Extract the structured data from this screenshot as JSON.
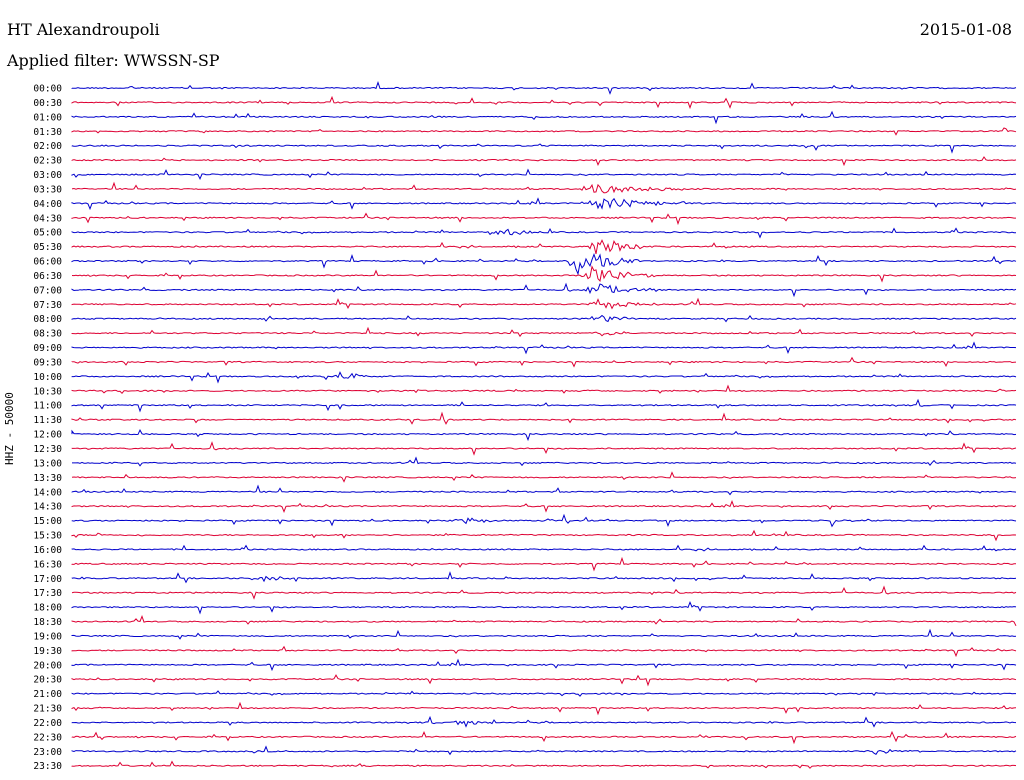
{
  "header": {
    "station": "HT Alexandroupoli",
    "date": "2015-01-08",
    "filter": "Applied filter: WWSSN-SP"
  },
  "chart_data": {
    "type": "line",
    "title": "HT Alexandroupoli",
    "subtitle": "Applied filter: WWSSN-SP",
    "date": "2015-01-08",
    "ylabel": "HHZ - 50000",
    "trace_colors": [
      "#0000cc",
      "#dd0033"
    ],
    "row_labels": [
      "00:00",
      "00:30",
      "01:00",
      "01:30",
      "02:00",
      "02:30",
      "03:00",
      "03:30",
      "04:00",
      "04:30",
      "05:00",
      "05:30",
      "06:00",
      "06:30",
      "07:00",
      "07:30",
      "08:00",
      "08:30",
      "09:00",
      "09:30",
      "10:00",
      "10:30",
      "11:00",
      "11:30",
      "12:00",
      "12:30",
      "13:00",
      "13:30",
      "14:00",
      "14:30",
      "15:00",
      "15:30",
      "16:00",
      "16:30",
      "17:00",
      "17:30",
      "18:00",
      "18:30",
      "19:00",
      "19:30",
      "20:00",
      "20:30",
      "21:00",
      "21:30",
      "22:00",
      "22:30",
      "23:00",
      "23:30"
    ],
    "events": [
      {
        "row": "03:30",
        "minute": 16.5,
        "amplitude": 6,
        "duration_min": 3
      },
      {
        "row": "04:00",
        "minute": 16.5,
        "amplitude": 7,
        "duration_min": 3
      },
      {
        "row": "05:00",
        "minute": 13.5,
        "amplitude": 5,
        "duration_min": 1.5
      },
      {
        "row": "05:30",
        "minute": 16.7,
        "amplitude": 9,
        "duration_min": 2
      },
      {
        "row": "06:00",
        "minute": 16.0,
        "amplitude": 14,
        "duration_min": 2
      },
      {
        "row": "06:30",
        "minute": 16.5,
        "amplitude": 10,
        "duration_min": 2
      },
      {
        "row": "07:00",
        "minute": 16.6,
        "amplitude": 8,
        "duration_min": 2
      },
      {
        "row": "07:30",
        "minute": 16.7,
        "amplitude": 6,
        "duration_min": 2
      },
      {
        "row": "08:00",
        "minute": 16.8,
        "amplitude": 5,
        "duration_min": 1
      },
      {
        "row": "08:30",
        "minute": 16.8,
        "amplitude": 4,
        "duration_min": 1
      },
      {
        "row": "10:00",
        "minute": 8.5,
        "amplitude": 4,
        "duration_min": 1.5
      },
      {
        "row": "15:00",
        "minute": 12.5,
        "amplitude": 4,
        "duration_min": 1
      },
      {
        "row": "17:00",
        "minute": 6.0,
        "amplitude": 4,
        "duration_min": 1
      },
      {
        "row": "22:00",
        "minute": 12.5,
        "amplitude": 4,
        "duration_min": 1
      },
      {
        "row": "23:00",
        "minute": 25.5,
        "amplitude": 4,
        "duration_min": 1.5
      }
    ]
  }
}
